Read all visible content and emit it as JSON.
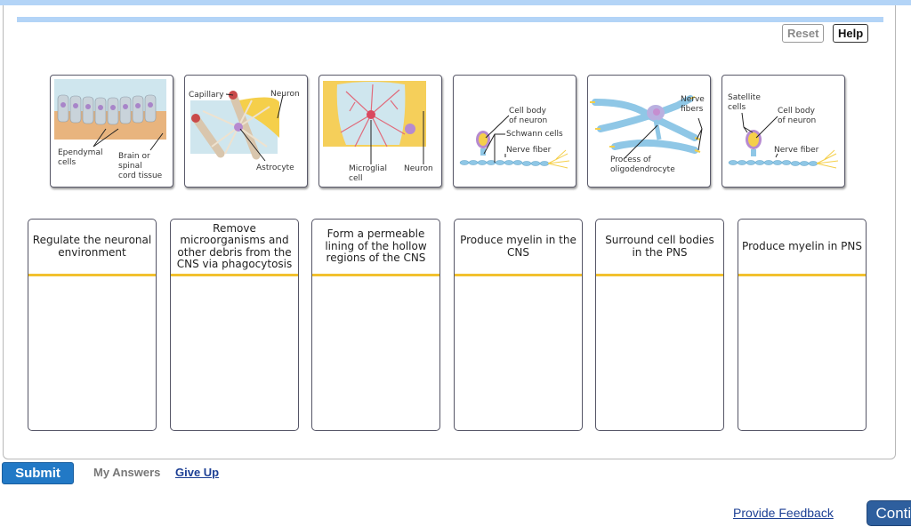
{
  "toolbar": {
    "reset_label": "Reset",
    "help_label": "Help"
  },
  "tiles": [
    {
      "name": "ependymal-cells",
      "labels": [
        "Ependymal",
        "cells",
        "Brain or",
        "spinal",
        "cord tissue"
      ]
    },
    {
      "name": "astrocyte",
      "labels": [
        "Capillary",
        "Neuron",
        "Astrocyte"
      ]
    },
    {
      "name": "microglial-cell",
      "labels": [
        "Microglial",
        "cell",
        "Neuron"
      ]
    },
    {
      "name": "schwann-cells",
      "labels": [
        "Cell body",
        "of neuron",
        "Schwann cells",
        "Nerve fiber"
      ]
    },
    {
      "name": "oligodendrocyte",
      "labels": [
        "Nerve",
        "fibers",
        "Process of",
        "oligodendrocyte"
      ]
    },
    {
      "name": "satellite-cells",
      "labels": [
        "Satellite",
        "cells",
        "Cell body",
        "of neuron",
        "Nerve fiber"
      ]
    }
  ],
  "bins": [
    {
      "label": "Regulate the neuronal environment"
    },
    {
      "label": "Remove microorganisms and other debris from the CNS via phagocytosis"
    },
    {
      "label": "Form a permeable lining of the hollow regions of the CNS"
    },
    {
      "label": "Produce myelin in the CNS"
    },
    {
      "label": "Surround cell bodies in the PNS"
    },
    {
      "label": "Produce myelin in PNS"
    }
  ],
  "footer": {
    "submit_label": "Submit",
    "my_answers_label": "My Answers",
    "give_up_label": "Give Up",
    "feedback_label": "Provide Feedback",
    "continue_label": "Continue"
  },
  "colors": {
    "accent": "#2279c6",
    "bin_divider": "#f2c12e",
    "link": "#1c3f94",
    "top_strip": "#b3d4f7"
  }
}
